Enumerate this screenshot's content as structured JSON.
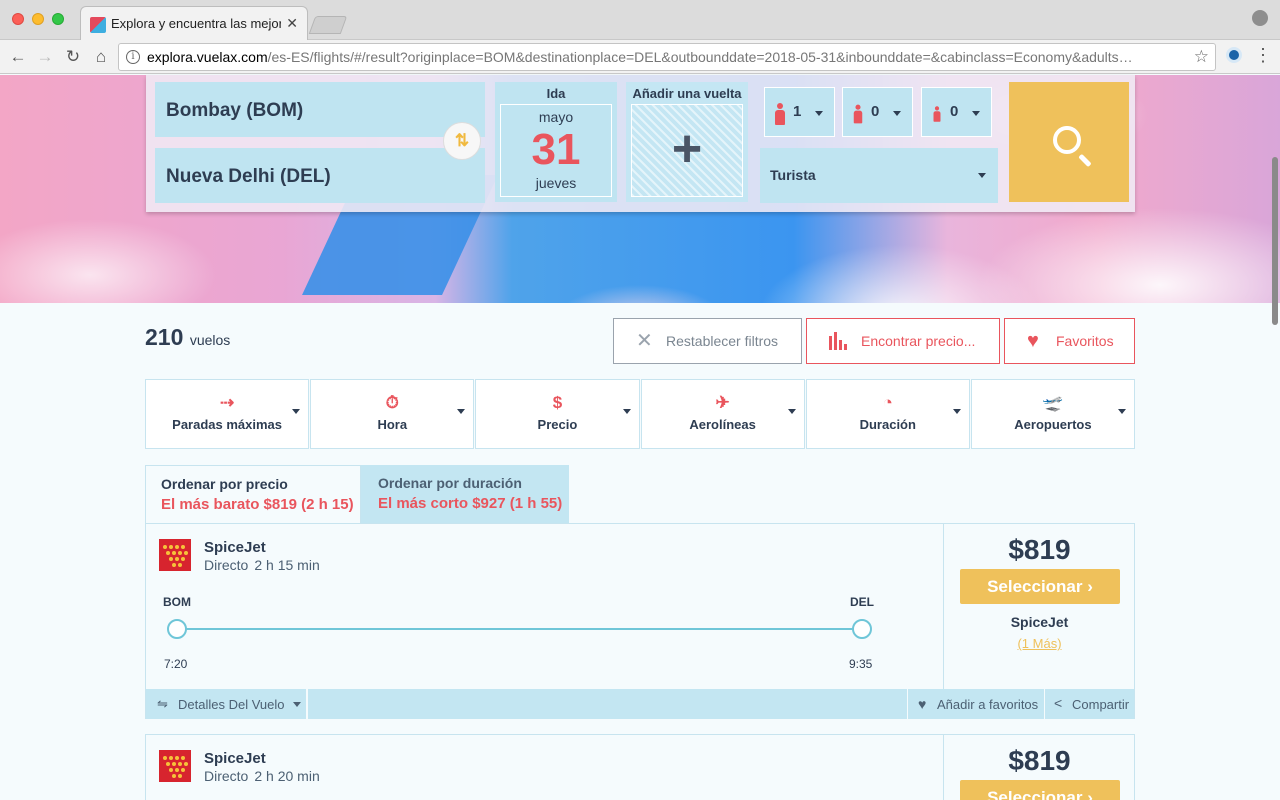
{
  "browser": {
    "tab_title": "Explora y encuentra las mejores",
    "tab_close": "✕",
    "url_host": "explora.vuelax.com",
    "url_rest": "/es-ES/flights/#/result?originplace=BOM&destinationplace=DEL&outbounddate=2018-05-31&inbounddate=&cabinclass=Economy&adults…"
  },
  "search": {
    "origin": "Bombay (BOM)",
    "destination": "Nueva Delhi (DEL)",
    "date_label": "Ida",
    "date_month": "mayo",
    "date_day": "31",
    "date_weekday": "jueves",
    "return_label": "Añadir una vuelta",
    "adults": "1",
    "children": "0",
    "infants": "0",
    "cabin": "Turista"
  },
  "results": {
    "count": "210",
    "count_word": "vuelos",
    "reset_label": "Restablecer filtros",
    "find_price_label": "Encontrar precio...",
    "favorites_label": "Favoritos"
  },
  "filters": [
    {
      "label": "Paradas máximas",
      "icon": "stops-icon"
    },
    {
      "label": "Hora",
      "icon": "stopwatch-icon"
    },
    {
      "label": "Precio",
      "icon": "price-icon"
    },
    {
      "label": "Aerolíneas",
      "icon": "airplane-icon"
    },
    {
      "label": "Duración",
      "icon": "duration-icon"
    },
    {
      "label": "Aeropuertos",
      "icon": "airport-icon"
    }
  ],
  "sort": {
    "price_title": "Ordenar por precio",
    "price_sub": "El más barato $819 (2 h 15)",
    "duration_title": "Ordenar por duración",
    "duration_sub": "El más corto $927 (1 h 55)"
  },
  "flights": [
    {
      "airline": "SpiceJet",
      "stops": "Directo",
      "duration": "2 h 15 min",
      "from": "BOM",
      "to": "DEL",
      "depart": "7:20",
      "arrive": "9:35",
      "price": "$819",
      "select_label": "Seleccionar",
      "seller": "SpiceJet",
      "more": "(1 Más)",
      "details_label": "Detalles Del Vuelo",
      "fav_label": "Añadir a favoritos",
      "share_label": "Compartir"
    },
    {
      "airline": "SpiceJet",
      "stops": "Directo",
      "duration": "2 h 20 min",
      "price": "$819",
      "select_label": "Seleccionar"
    }
  ],
  "colors": {
    "accent_red": "#e9555d",
    "accent_yellow": "#efc15b",
    "navy": "#2e3d52",
    "field_blue": "#bfe4f1"
  }
}
